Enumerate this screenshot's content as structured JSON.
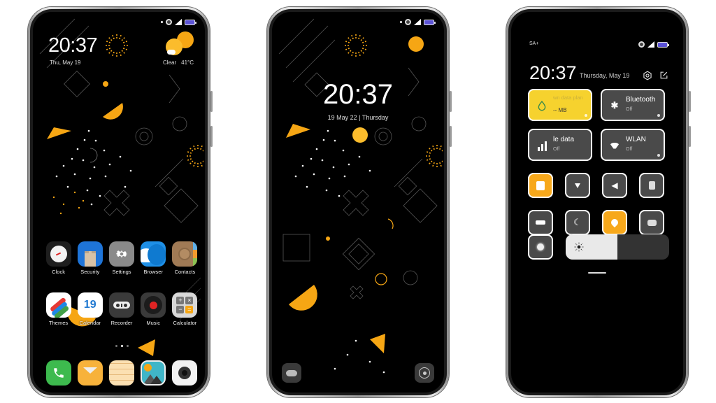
{
  "colors": {
    "accent": "#f7a81b",
    "accent_yellow_tile": "#f6d22e",
    "tile_off": "#4a4a4a",
    "battery": "#5b52d6",
    "screen_bg": "#000000"
  },
  "home_screen": {
    "clock": "20:37",
    "date": "Thu, May 19",
    "weather": {
      "condition": "Clear",
      "temperature": "41°C",
      "icon": "sun-cloud-icon"
    },
    "apps_row1": [
      {
        "label": "Clock",
        "icon": "clock-icon"
      },
      {
        "label": "Security",
        "icon": "security-tower-icon"
      },
      {
        "label": "Settings",
        "icon": "gear-icon"
      },
      {
        "label": "Browser",
        "icon": "wave-icon"
      },
      {
        "label": "Contacts",
        "icon": "contacts-book-icon"
      }
    ],
    "apps_row2": [
      {
        "label": "Themes",
        "icon": "themes-icon"
      },
      {
        "label": "Calendar",
        "icon": "calendar-icon",
        "day": "19"
      },
      {
        "label": "Recorder",
        "icon": "recorder-icon"
      },
      {
        "label": "Music",
        "icon": "vinyl-icon"
      },
      {
        "label": "Calculator",
        "icon": "calculator-icon"
      }
    ],
    "page_indicator": {
      "pages": 3,
      "current": 2
    },
    "dock": [
      {
        "name": "phone",
        "icon": "phone-icon"
      },
      {
        "name": "messages",
        "icon": "envelope-icon"
      },
      {
        "name": "notes",
        "icon": "notes-icon"
      },
      {
        "name": "gallery",
        "icon": "gallery-icon"
      },
      {
        "name": "camera",
        "icon": "camera-icon"
      }
    ]
  },
  "lock_screen": {
    "clock": "20:37",
    "date": "19 May 22 | Thursday",
    "left_shortcut": "weather-cloud-icon",
    "right_shortcut": "camera-shutter-icon"
  },
  "control_center": {
    "carrier": "SA+",
    "clock": "20:37",
    "date": "Thursday, May 19",
    "big_tiles": [
      {
        "title": "wn data plan",
        "subtitle": "-- MB",
        "icon": "water-drop-icon",
        "active": true
      },
      {
        "title": "Bluetooth",
        "subtitle": "Off",
        "icon": "bluetooth-icon",
        "active": false
      },
      {
        "title": "le data",
        "subtitle": "Off",
        "icon": "signal-bars-icon",
        "active": false
      },
      {
        "title": "WLAN",
        "subtitle": "Off",
        "icon": "wifi-icon",
        "active": false
      }
    ],
    "small_tiles": [
      {
        "name": "vibrate",
        "icon": "vibrate-icon",
        "active": true
      },
      {
        "name": "flashlight",
        "icon": "flashlight-icon",
        "active": false
      },
      {
        "name": "sound",
        "icon": "speaker-icon",
        "active": false
      },
      {
        "name": "screenshot",
        "icon": "screenshot-icon",
        "active": false
      },
      {
        "name": "airplane-mode",
        "icon": "airplane-icon",
        "active": false
      },
      {
        "name": "dark-mode",
        "icon": "moon-icon",
        "active": false
      },
      {
        "name": "location",
        "icon": "location-pin-icon",
        "active": true
      },
      {
        "name": "reading-mode",
        "icon": "eye-comfort-icon",
        "active": false
      },
      {
        "name": "auto-brightness",
        "icon": "auto-brightness-icon",
        "active": false
      }
    ],
    "brightness_level": 0.5
  }
}
